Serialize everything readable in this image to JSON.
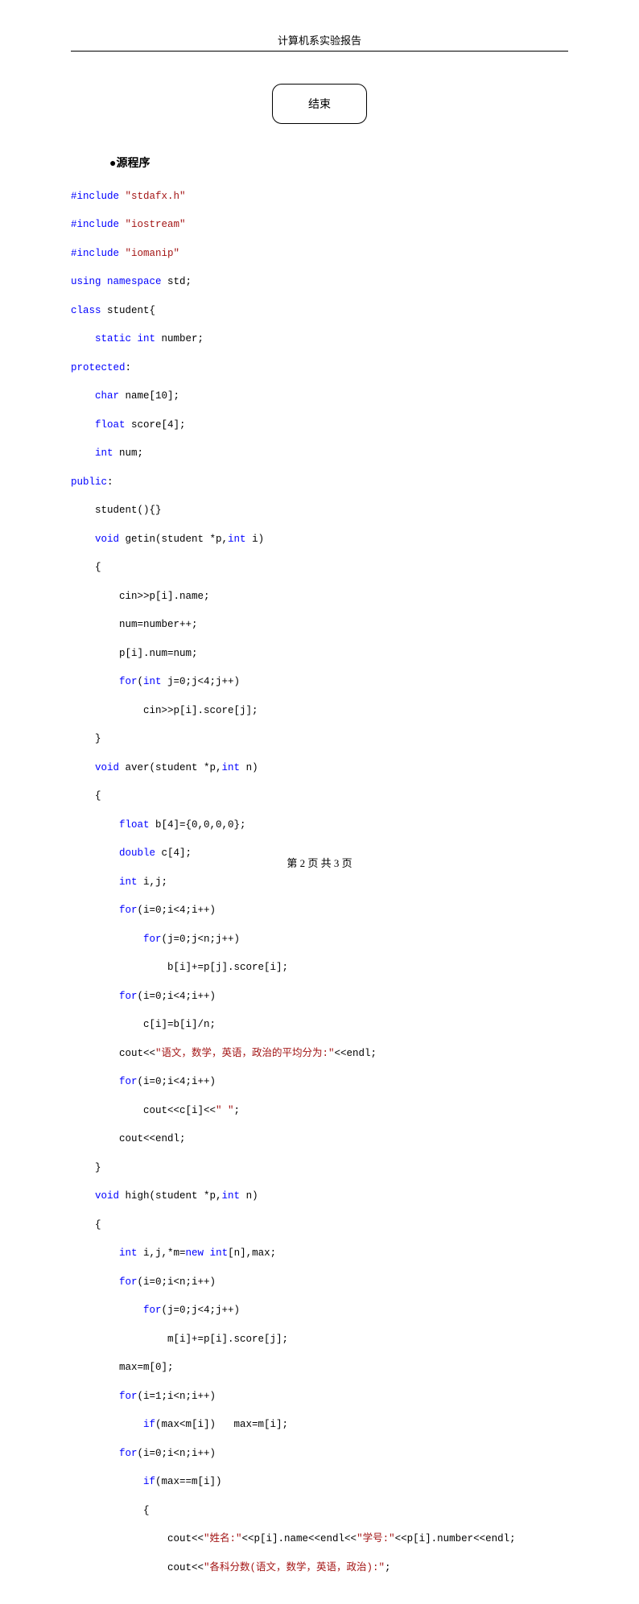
{
  "header": "计算机系实验报告",
  "box_text": "结束",
  "section_title": "●源程序",
  "footer": "第 2 页 共 3 页",
  "code": {
    "l1_a": "#include ",
    "l1_b": "\"stdafx.h\"",
    "l2_a": "#include ",
    "l2_b": "\"iostream\"",
    "l3_a": "#include ",
    "l3_b": "\"iomanip\"",
    "l4_a": "using",
    "l4_b": " ",
    "l4_c": "namespace",
    "l4_d": " std;",
    "l5_a": "class",
    "l5_b": " student{",
    "l6_a": "static",
    "l6_b": " ",
    "l6_c": "int",
    "l6_d": " number;",
    "l7_a": "protected",
    "l7_b": ":",
    "l8_a": "char",
    "l8_b": " name[10];",
    "l9_a": "float",
    "l9_b": " score[4];",
    "l10_a": "int",
    "l10_b": " num;",
    "l11_a": "public",
    "l11_b": ":",
    "l12": "student(){}",
    "l13_a": "void",
    "l13_b": " getin(student *p,",
    "l13_c": "int",
    "l13_d": " i)",
    "l14": "{",
    "l15": "cin>>p[i].name;",
    "l16": "num=number++;",
    "l17": "p[i].num=num;",
    "l18_a": "for",
    "l18_b": "(",
    "l18_c": "int",
    "l18_d": " j=0;j<4;j++)",
    "l19": "cin>>p[i].score[j];",
    "l20": "}",
    "l21_a": "void",
    "l21_b": " aver(student *p,",
    "l21_c": "int",
    "l21_d": " n)",
    "l22": "{",
    "l23_a": "float",
    "l23_b": " b[4]={0,0,0,0};",
    "l24_a": "double",
    "l24_b": " c[4];",
    "l25_a": "int",
    "l25_b": " i,j;",
    "l26_a": "for",
    "l26_b": "(i=0;i<4;i++)",
    "l27_a": "for",
    "l27_b": "(j=0;j<n;j++)",
    "l28": "b[i]+=p[j].score[i];",
    "l29_a": "for",
    "l29_b": "(i=0;i<4;i++)",
    "l30": "c[i]=b[i]/n;",
    "l31_a": "cout<<",
    "l31_b": "\"语文，数学，英语，政治的平均分为:\"",
    "l31_c": "<<endl;",
    "l32_a": "for",
    "l32_b": "(i=0;i<4;i++)",
    "l33_a": "cout<<c[i]<<",
    "l33_b": "\" \"",
    "l33_c": ";",
    "l34": "cout<<endl;",
    "l35": "}",
    "l36_a": "void",
    "l36_b": " high(student *p,",
    "l36_c": "int",
    "l36_d": " n)",
    "l37": "{",
    "l38_a": "int",
    "l38_b": " i,j,*m=",
    "l38_c": "new",
    "l38_d": " ",
    "l38_e": "int",
    "l38_f": "[n],max;",
    "l39_a": "for",
    "l39_b": "(i=0;i<n;i++)",
    "l40_a": "for",
    "l40_b": "(j=0;j<4;j++)",
    "l41": "m[i]+=p[i].score[j];",
    "l42": "max=m[0];",
    "l43_a": "for",
    "l43_b": "(i=1;i<n;i++)",
    "l44_a": "if",
    "l44_b": "(max<m[i])   max=m[i];",
    "l45_a": "for",
    "l45_b": "(i=0;i<n;i++)",
    "l46_a": "if",
    "l46_b": "(max==m[i])",
    "l47": "{",
    "l48_a": "cout<<",
    "l48_b": "\"姓名:\"",
    "l48_c": "<<p[i].name<<endl<<",
    "l48_d": "\"学号:\"",
    "l48_e": "<<p[i].number<<endl;",
    "l49_a": "cout<<",
    "l49_b": "\"各科分数(语文，数学，英语，政治):\"",
    "l49_c": ";"
  }
}
